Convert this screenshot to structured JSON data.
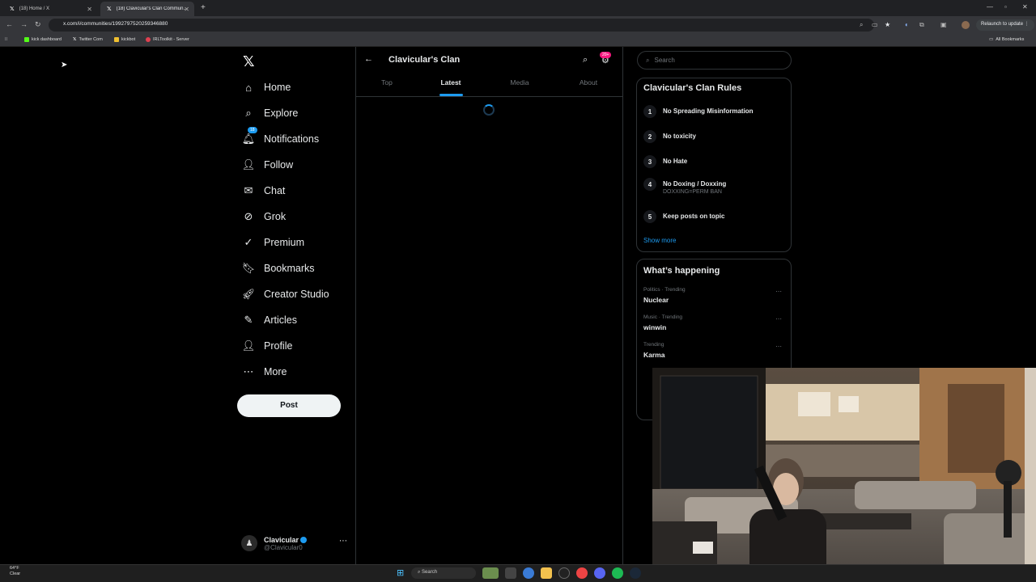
{
  "browser": {
    "tabs": [
      {
        "label": "(18) Home / X"
      },
      {
        "label": "(18) Clavicular's Clan Commun..."
      }
    ],
    "url": "x.com/i/communities/1992797520259346880",
    "relaunch_label": "Relaunch to update",
    "bookmarks": [
      "kick dashboard",
      "Twitter Com",
      "kickbot",
      "IRLToolkit - Server"
    ],
    "all_bookmarks_label": "All Bookmarks"
  },
  "nav": {
    "items": [
      {
        "label": "Home",
        "icon": "home-icon",
        "glyph": "⌂"
      },
      {
        "label": "Explore",
        "icon": "search-icon",
        "glyph": "⌕"
      },
      {
        "label": "Notifications",
        "icon": "bell-icon",
        "glyph": "🔔︎",
        "badge": "18"
      },
      {
        "label": "Follow",
        "icon": "follow-icon",
        "glyph": "👤︎"
      },
      {
        "label": "Chat",
        "icon": "mail-icon",
        "glyph": "✉"
      },
      {
        "label": "Grok",
        "icon": "grok-icon",
        "glyph": "⊘"
      },
      {
        "label": "Premium",
        "icon": "premium-icon",
        "glyph": "✓"
      },
      {
        "label": "Bookmarks",
        "icon": "bookmark-icon",
        "glyph": "🔖︎"
      },
      {
        "label": "Creator Studio",
        "icon": "rocket-icon",
        "glyph": "🚀︎"
      },
      {
        "label": "Articles",
        "icon": "article-icon",
        "glyph": "✎"
      },
      {
        "label": "Profile",
        "icon": "profile-icon",
        "glyph": "👤︎"
      },
      {
        "label": "More",
        "icon": "more-icon",
        "glyph": "⋯"
      }
    ],
    "post_label": "Post",
    "account": {
      "name": "Clavicular",
      "handle": "@Clavicular0"
    }
  },
  "community": {
    "title": "Clavicular's Clan",
    "notif_badge": "20+",
    "tabs": [
      "Top",
      "Latest",
      "Media",
      "About"
    ],
    "active_tab": "Latest"
  },
  "sidebar": {
    "search_placeholder": "Search",
    "rules_title": "Clavicular's Clan Rules",
    "rules": [
      {
        "num": "1",
        "title": "No Spreading Misinformation",
        "sub": ""
      },
      {
        "num": "2",
        "title": "No toxicity",
        "sub": ""
      },
      {
        "num": "3",
        "title": "No Hate",
        "sub": ""
      },
      {
        "num": "4",
        "title": "No Doxing / Doxxing",
        "sub": "DOXXING=PERM BAN"
      },
      {
        "num": "5",
        "title": "Keep posts on topic",
        "sub": ""
      }
    ],
    "show_more": "Show more",
    "happening_title": "What’s happening",
    "trends": [
      {
        "category": "Politics · Trending",
        "name": "Nuclear"
      },
      {
        "category": "Music · Trending",
        "name": "winwin"
      },
      {
        "category": "Trending",
        "name": "Karma"
      }
    ]
  },
  "taskbar": {
    "weather_temp": "64°F",
    "weather_desc": "Clear",
    "search_label": "Search"
  }
}
